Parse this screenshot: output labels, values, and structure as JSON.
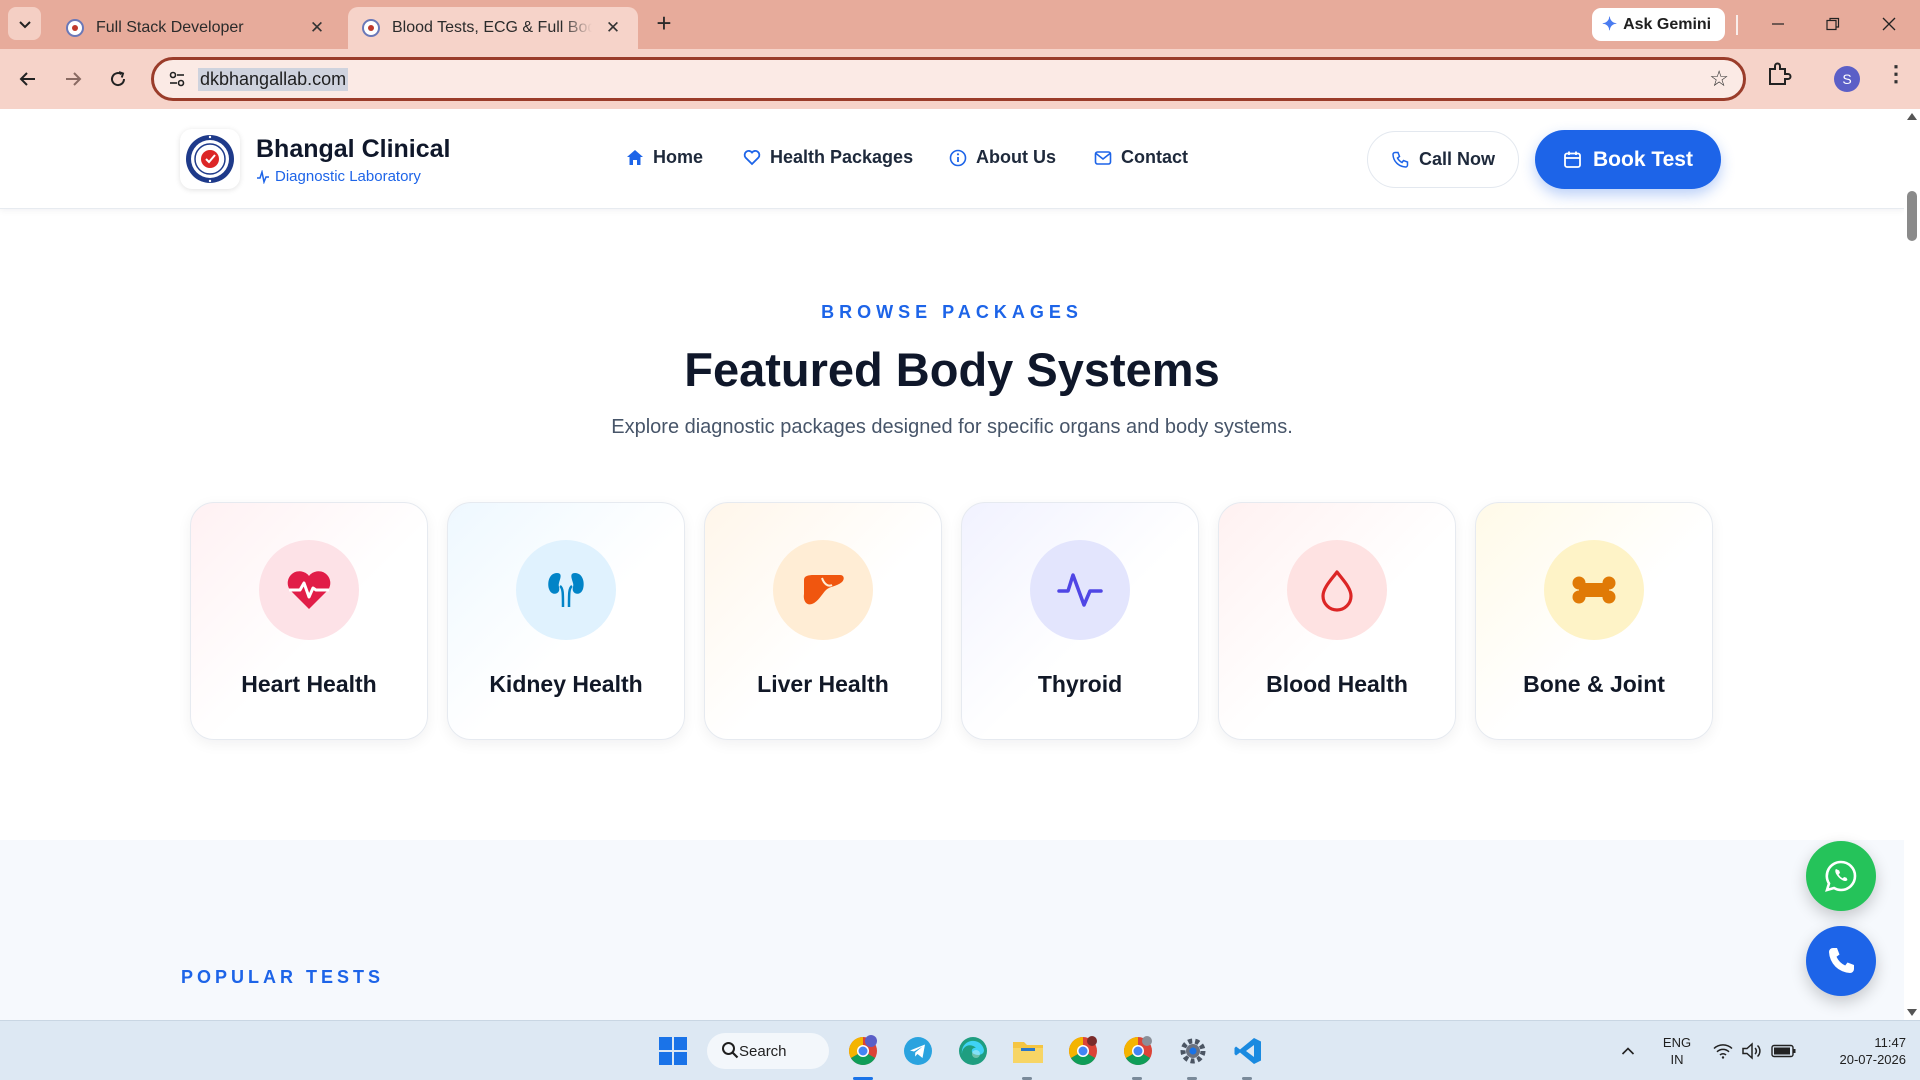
{
  "browser": {
    "tabs": [
      {
        "title": "Full Stack Developer",
        "active": false
      },
      {
        "title": "Blood Tests, ECG & Full Body Checkup",
        "active": true
      }
    ],
    "gemini_label": "Ask Gemini",
    "url": "dkbhangallab.com",
    "profile_initial": "S"
  },
  "site": {
    "brand_name": "Bhangal Clinical",
    "brand_sub": "Diagnostic Laboratory",
    "nav": [
      {
        "label": "Home",
        "icon": "home-icon"
      },
      {
        "label": "Health Packages",
        "icon": "heart-outline-icon"
      },
      {
        "label": "About Us",
        "icon": "info-icon"
      },
      {
        "label": "Contact",
        "icon": "mail-icon"
      }
    ],
    "call_label": "Call Now",
    "book_label": "Book Test"
  },
  "featured": {
    "eyebrow": "BROWSE PACKAGES",
    "title": "Featured Body Systems",
    "subtitle": "Explore diagnostic packages designed for specific organs and body systems.",
    "cards": [
      {
        "label": "Heart Health",
        "icon": "heart-pulse-icon",
        "color": "#e11d48",
        "bg": "#fde2e7"
      },
      {
        "label": "Kidney Health",
        "icon": "kidney-icon",
        "color": "#0284c7",
        "bg": "#e0f2fe"
      },
      {
        "label": "Liver Health",
        "icon": "liver-icon",
        "color": "#f0560f",
        "bg": "#ffedd5"
      },
      {
        "label": "Thyroid",
        "icon": "activity-icon",
        "color": "#5046e5",
        "bg": "#e3e5fd"
      },
      {
        "label": "Blood Health",
        "icon": "droplet-icon",
        "color": "#dc2626",
        "bg": "#fee2e2"
      },
      {
        "label": "Bone & Joint",
        "icon": "bone-icon",
        "color": "#e07a06",
        "bg": "#fef3c7"
      }
    ]
  },
  "popular": {
    "eyebrow": "POPULAR TESTS"
  },
  "taskbar": {
    "search_label": "Search",
    "lang_top": "ENG",
    "lang_bottom": "IN",
    "time": "11:47",
    "date": "20-07-2026"
  },
  "colors": {
    "accent": "#1d64e8",
    "whatsapp": "#25c35a",
    "chrome_frame": "#e7ab9b"
  }
}
